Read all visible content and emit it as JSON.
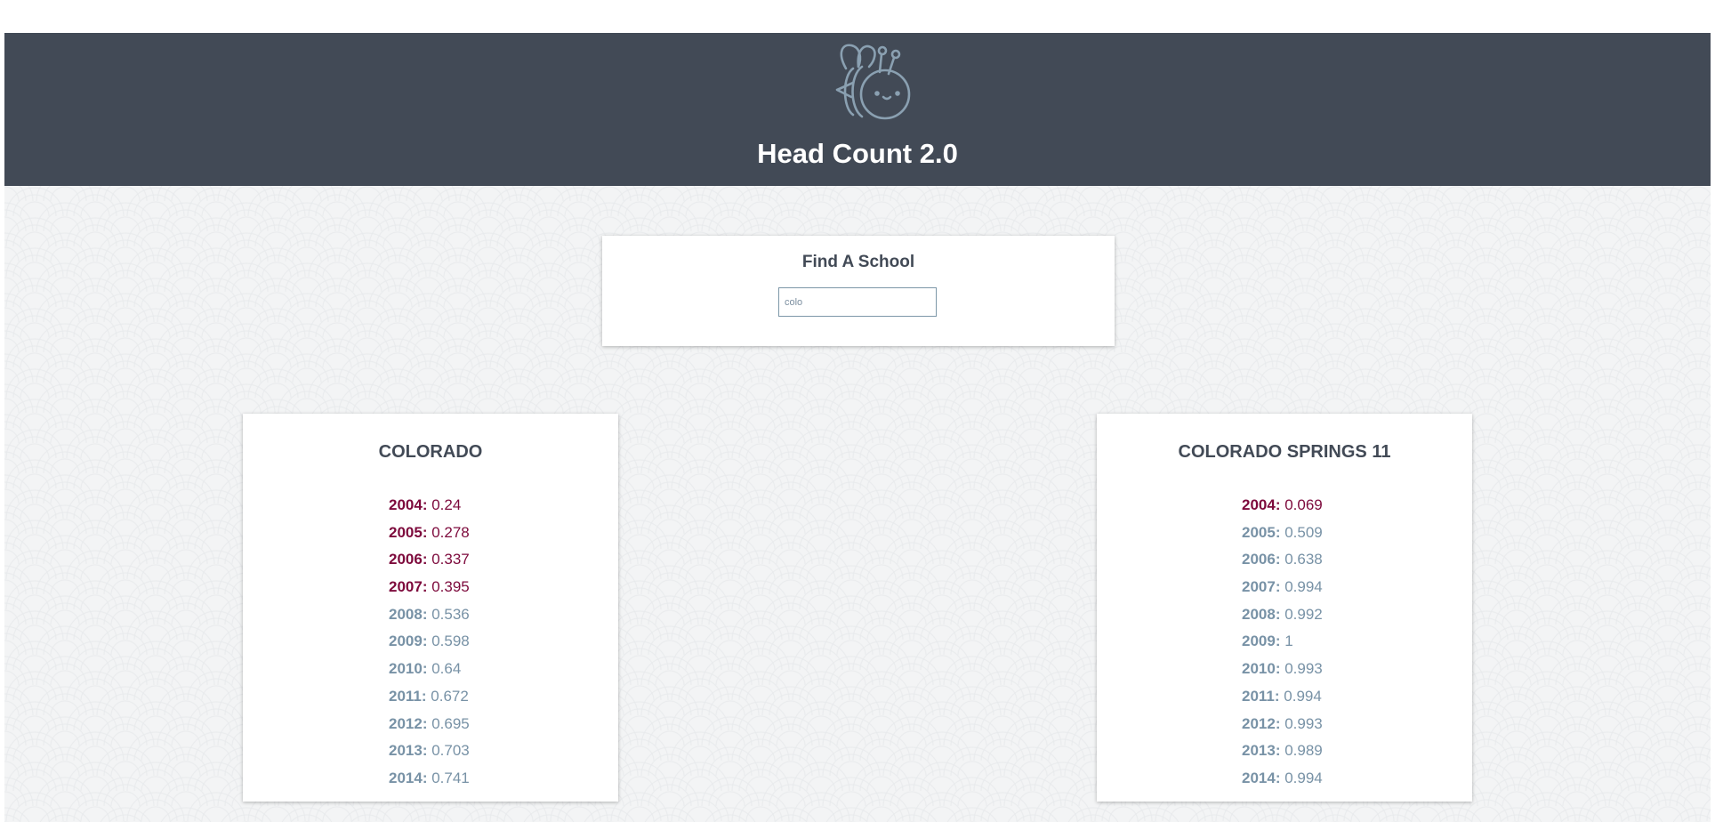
{
  "app": {
    "title": "Head Count 2.0",
    "logo_icon": "bee-logo-icon"
  },
  "search": {
    "title": "Find A School",
    "value": "colo",
    "placeholder": ""
  },
  "colors": {
    "header": "#424a56",
    "below_threshold": "#7d0a3c",
    "above_threshold": "#7892a6"
  },
  "districts": [
    {
      "name": "COLORADO",
      "rows": [
        {
          "year": "2004:",
          "value": "0.24",
          "status": "low"
        },
        {
          "year": "2005:",
          "value": "0.278",
          "status": "low"
        },
        {
          "year": "2006:",
          "value": "0.337",
          "status": "low"
        },
        {
          "year": "2007:",
          "value": "0.395",
          "status": "low"
        },
        {
          "year": "2008:",
          "value": "0.536",
          "status": "high"
        },
        {
          "year": "2009:",
          "value": "0.598",
          "status": "high"
        },
        {
          "year": "2010:",
          "value": "0.64",
          "status": "high"
        },
        {
          "year": "2011:",
          "value": "0.672",
          "status": "high"
        },
        {
          "year": "2012:",
          "value": "0.695",
          "status": "high"
        },
        {
          "year": "2013:",
          "value": "0.703",
          "status": "high"
        },
        {
          "year": "2014:",
          "value": "0.741",
          "status": "high"
        }
      ]
    },
    {
      "name": "COLORADO SPRINGS 11",
      "rows": [
        {
          "year": "2004:",
          "value": "0.069",
          "status": "low"
        },
        {
          "year": "2005:",
          "value": "0.509",
          "status": "high"
        },
        {
          "year": "2006:",
          "value": "0.638",
          "status": "high"
        },
        {
          "year": "2007:",
          "value": "0.994",
          "status": "high"
        },
        {
          "year": "2008:",
          "value": "0.992",
          "status": "high"
        },
        {
          "year": "2009:",
          "value": "1",
          "status": "high"
        },
        {
          "year": "2010:",
          "value": "0.993",
          "status": "high"
        },
        {
          "year": "2011:",
          "value": "0.994",
          "status": "high"
        },
        {
          "year": "2012:",
          "value": "0.993",
          "status": "high"
        },
        {
          "year": "2013:",
          "value": "0.989",
          "status": "high"
        },
        {
          "year": "2014:",
          "value": "0.994",
          "status": "high"
        }
      ]
    }
  ]
}
